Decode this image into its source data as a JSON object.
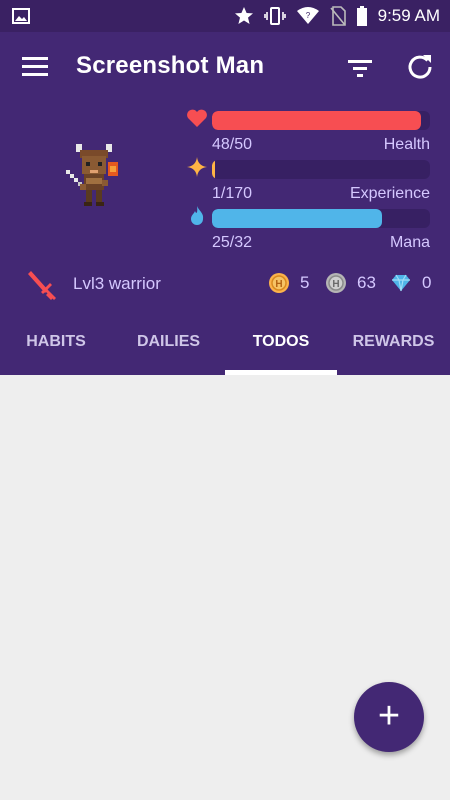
{
  "status_bar": {
    "time": "9:59 AM"
  },
  "toolbar": {
    "title": "Screenshot Man"
  },
  "stats": {
    "health": {
      "value": "48/50",
      "label": "Health",
      "fraction": 0.96,
      "color": "#f74e52"
    },
    "experience": {
      "value": "1/170",
      "label": "Experience",
      "fraction": 0.006,
      "color": "#ffb445"
    },
    "mana": {
      "value": "25/32",
      "label": "Mana",
      "fraction": 0.78,
      "color": "#50b5e9"
    }
  },
  "profile": {
    "class_label": "Lvl3 warrior"
  },
  "currencies": {
    "gold": "5",
    "silver": "63",
    "gems": "0"
  },
  "tabs": {
    "habits": "HABITS",
    "dailies": "DAILIES",
    "todos": "TODOS",
    "rewards": "REWARDS"
  },
  "fab": {
    "label": "+"
  },
  "colors": {
    "primary": "#432874",
    "status_bar": "#3a2163",
    "background": "#eeeeee"
  }
}
